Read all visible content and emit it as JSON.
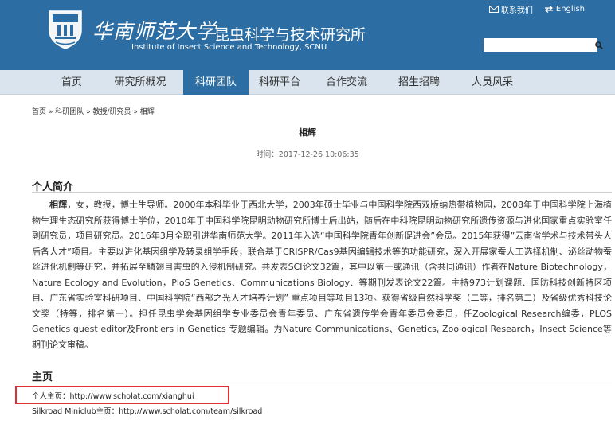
{
  "header": {
    "university_script": "华南师范大学",
    "institute_cn": "昆虫科学与技术研究所",
    "institute_en": "Institute of Insect Science and Technology, SCNU",
    "contact_label": "联系我们",
    "english_label": "English",
    "search_placeholder": ""
  },
  "nav": {
    "items": [
      {
        "label": "首页"
      },
      {
        "label": "研究所概况"
      },
      {
        "label": "科研团队"
      },
      {
        "label": "科研平台"
      },
      {
        "label": "合作交流"
      },
      {
        "label": "招生招聘"
      },
      {
        "label": "人员风采"
      }
    ],
    "active_index": 2
  },
  "breadcrumb": "首页 » 科研团队 » 教授/研究员 » 相辉",
  "article": {
    "title": "相辉",
    "time": "时间：2017-12-26 10:06:35"
  },
  "bio": {
    "heading": "个人简介",
    "name": "相辉",
    "text": "，女，教授，博士生导师。2000年本科毕业于西北大学，2003年硕士毕业与中国科学院西双版纳热带植物园，2008年于中国科学院上海植物生理生态研究所获得博士学位，2010年于中国科学院昆明动物研究所博士后出站，随后在中科院昆明动物研究所遗传资源与进化国家重点实验室任副研究员，项目研究员。2016年3月全职引进华南师范大学。2011年入选“中国科学院青年创新促进会”会员。2015年获得”云南省学术与技术带头人后备人才”项目。主要以进化基因组学及转录组学手段，联合基于CRISPR/Cas9基因编辑技术等的功能研究，深入开展家蚕人工选择机制、泌丝动物蚕丝进化机制等研究，并拓展至鳞翅目害虫的入侵机制研究。共发表SCI论文32篇，其中以第一或通讯（含共同通讯）作者在Nature Biotechnology，Nature Ecology and Evolution，PloS Genetics、Communications Biology、等期刊发表论文22篇。主持973计划课题、国防科技创新特区项目、广东省实验室科研项目、中国科学院“西部之光人才培养计划” 重点项目等项目13项。获得省级自然科学奖（二等，排名第二）及省级优秀科技论文奖（特等，排名第一）。担任昆虫学会基因组学专业委员会青年委员、广东省遗传学会青年委员会委员，任Zoological Research编委，PLOS Genetics guest editor及Frontiers in Genetics 专题编辑。为Nature Communications、Genetics, Zoological Research，Insect Science等期刊论文审稿。"
  },
  "homepage_section": {
    "heading": "主页",
    "personal": "个人主页：http://www.scholat.com/xianghui",
    "silkroad": "Silkroad Miniclub主页：http://www.scholat.com/team/silkroad"
  },
  "colors": {
    "brand_blue": "#2c6ea3",
    "nav_bg": "#d9e4ee",
    "highlight_red": "#e03030"
  }
}
